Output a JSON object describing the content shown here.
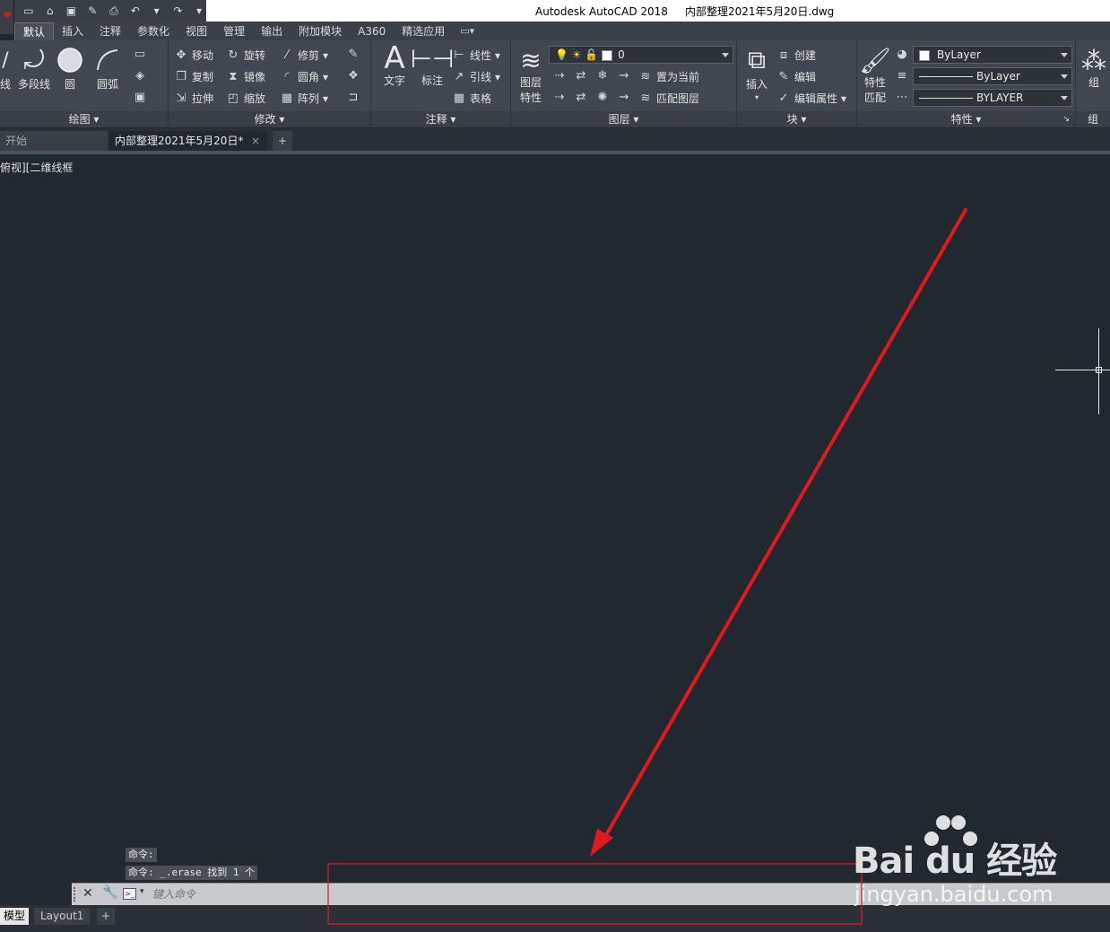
{
  "titlebar": {
    "title": "Autodesk AutoCAD 2018     内部整理2021年5月20日.dwg"
  },
  "ribbon_tabs": [
    {
      "label": "默认"
    },
    {
      "label": "插入"
    },
    {
      "label": "注释"
    },
    {
      "label": "参数化"
    },
    {
      "label": "视图"
    },
    {
      "label": "管理"
    },
    {
      "label": "输出"
    },
    {
      "label": "附加模块"
    },
    {
      "label": "A360"
    },
    {
      "label": "精选应用"
    }
  ],
  "panels": {
    "draw": {
      "title": "绘图",
      "line_label": "线",
      "polyline_label": "多段线",
      "circle_label": "圆",
      "arc_label": "圆弧"
    },
    "modify": {
      "title": "修改",
      "move": "移动",
      "rotate": "旋转",
      "trim": "修剪",
      "copy": "复制",
      "mirror": "镜像",
      "fillet": "圆角",
      "stretch": "拉伸",
      "scale": "缩放",
      "array": "阵列"
    },
    "annotation": {
      "title": "注释",
      "text": "文字",
      "dimension": "标注",
      "linear": "线性",
      "leader": "引线",
      "table": "表格"
    },
    "layers": {
      "title": "图层",
      "layer_props_1": "图层",
      "layer_props_2": "特性",
      "layer_value": "0",
      "set_current": "置为当前",
      "match_layer": "匹配图层"
    },
    "block": {
      "title": "块",
      "insert": "插入",
      "create": "创建",
      "edit": "编辑",
      "edit_attr": "编辑属性"
    },
    "properties": {
      "title": "特性",
      "match_props_1": "特性",
      "match_props_2": "匹配",
      "color": "ByLayer",
      "linetype": "ByLayer",
      "lineweight": "BYLAYER"
    },
    "groups": {
      "title": "组",
      "group": "组"
    }
  },
  "doc_tabs": {
    "start": "开始",
    "current": "内部整理2021年5月20日*",
    "add": "+"
  },
  "viewport_label": "俯视][二维线框",
  "command_history": [
    "命令:",
    "命令: _.erase 找到 1 个"
  ],
  "command_line": {
    "placeholder": "键入命令"
  },
  "layout_tabs": {
    "model": "模型",
    "layout1": "Layout1",
    "add": "+"
  },
  "watermark": {
    "brand": "Bai  du 经验",
    "url": "jingyan.baidu.com"
  },
  "annotation": {
    "color": "#e0191f"
  }
}
